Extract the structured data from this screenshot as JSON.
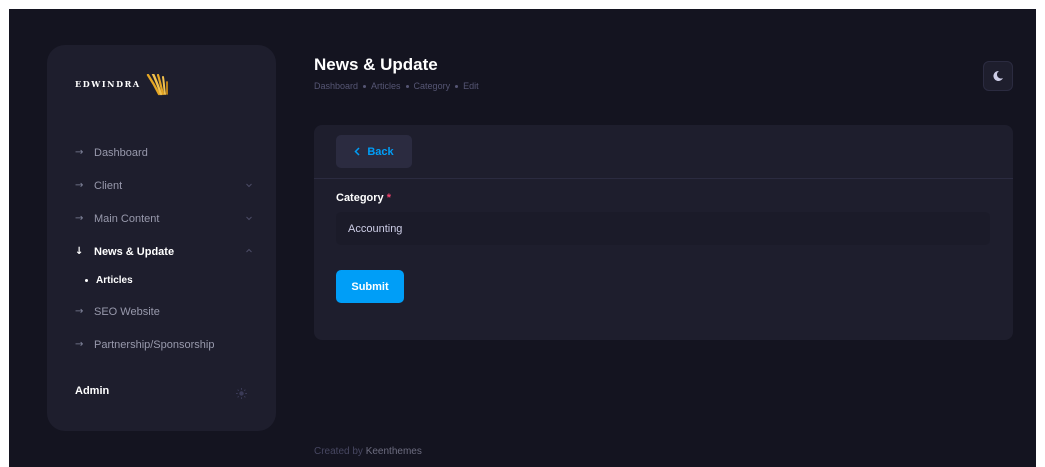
{
  "brand": {
    "name": "EDWINDRA",
    "accent": "#e5a623"
  },
  "sidebar": {
    "items": [
      {
        "label": "Dashboard",
        "icon": "arrow-right-icon",
        "active": false,
        "expandable": false
      },
      {
        "label": "Client",
        "icon": "arrow-right-icon",
        "active": false,
        "expandable": true
      },
      {
        "label": "Main Content",
        "icon": "arrow-right-icon",
        "active": false,
        "expandable": true
      },
      {
        "label": "News & Update",
        "icon": "arrow-down-icon",
        "active": true,
        "expandable": true,
        "expanded": true,
        "children": [
          {
            "label": "Articles",
            "active": true
          }
        ]
      },
      {
        "label": "SEO Website",
        "icon": "arrow-right-icon",
        "active": false,
        "expandable": false
      },
      {
        "label": "Partnership/Sponsorship",
        "icon": "arrow-right-icon",
        "active": false,
        "expandable": false
      }
    ],
    "user": {
      "name": "Admin",
      "toggle_icon": "sun-icon"
    }
  },
  "header": {
    "title": "News & Update",
    "breadcrumb": [
      "Dashboard",
      "Articles",
      "Category",
      "Edit"
    ],
    "theme_icon": "moon-icon"
  },
  "form": {
    "back_label": "Back",
    "category_label": "Category",
    "required_mark": "*",
    "category_value": "Accounting",
    "submit_label": "Submit"
  },
  "footer": {
    "prefix": "Created by",
    "link": "Keenthemes"
  },
  "colors": {
    "background": "#141420",
    "panel": "#1e1e2d",
    "primary": "#009ef7",
    "danger": "#f1416c"
  }
}
